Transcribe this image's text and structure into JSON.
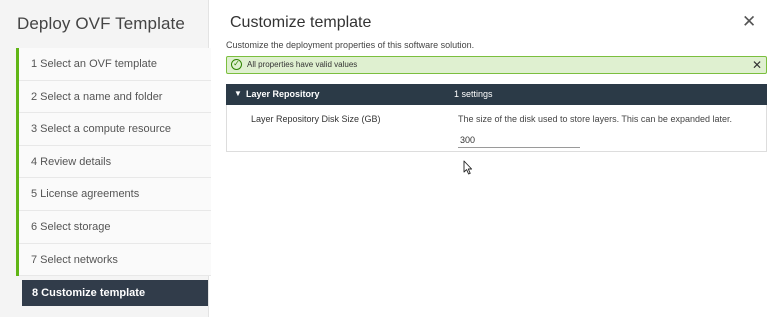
{
  "sidebar": {
    "title": "Deploy OVF Template",
    "steps": [
      {
        "label": "1  Select an OVF template"
      },
      {
        "label": "2  Select a name and folder"
      },
      {
        "label": "3  Select a compute resource"
      },
      {
        "label": "4  Review details"
      },
      {
        "label": "5  License agreements"
      },
      {
        "label": "6  Select storage"
      },
      {
        "label": "7  Select networks"
      }
    ],
    "active_step": "8  Customize template"
  },
  "main": {
    "title": "Customize template",
    "subtitle": "Customize the deployment properties of this software solution.",
    "close_icon": "close-icon",
    "banner": {
      "text": "All properties have valid values",
      "status_color": "#60b515"
    },
    "section": {
      "name": "Layer Repository",
      "count": "1 settings",
      "header_color": "#2b3a47"
    },
    "property": {
      "label": "Layer Repository Disk Size (GB)",
      "description": "The size of the disk used to store layers.  This can be expanded later.",
      "value": "300"
    }
  }
}
